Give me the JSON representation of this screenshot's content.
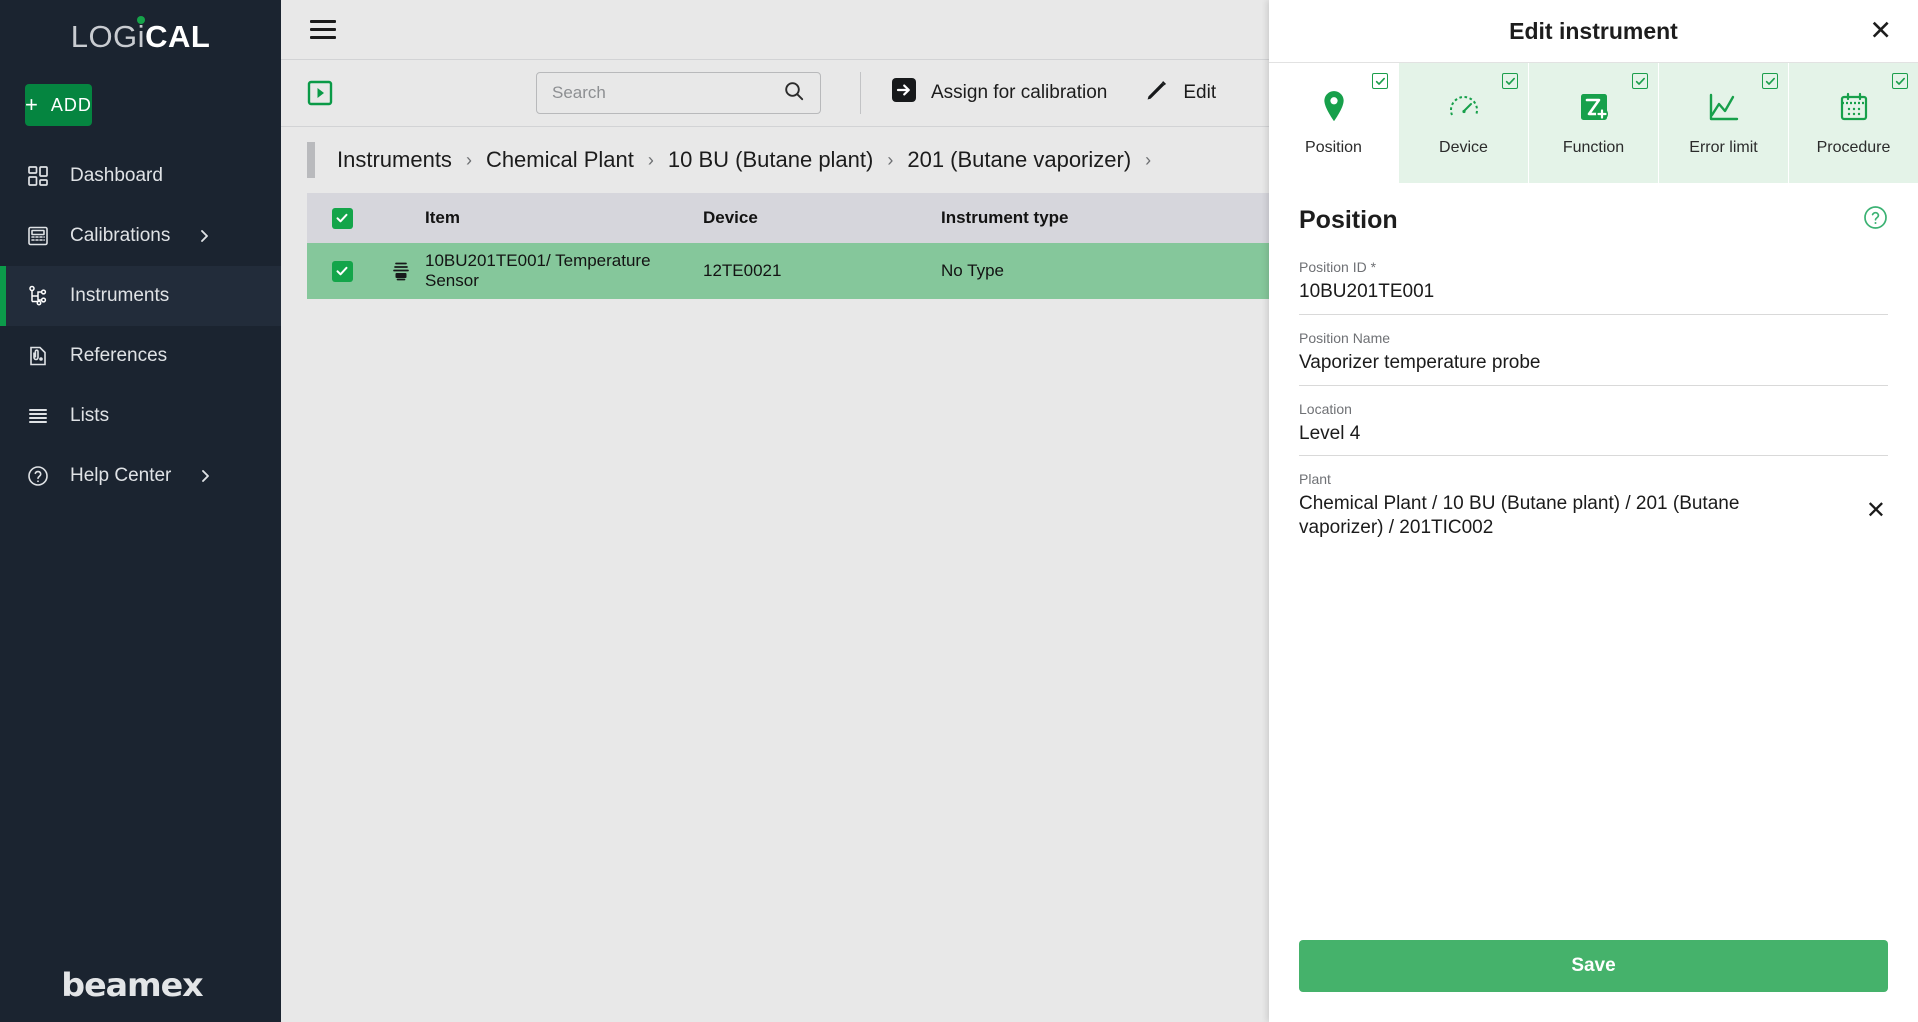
{
  "brand": {
    "logo_light": "LOG",
    "logo_i": "i",
    "logo_bold": "CAL",
    "footer_logo": "beamex",
    "accent_green": "#0c9b4a",
    "add_green": "#058540",
    "row_green": "#85c79b",
    "save_green": "#45b26b",
    "sidebar_bg": "#1b2430"
  },
  "sidebar": {
    "add_label": "ADD",
    "add_plus": "+",
    "items": [
      {
        "label": "Dashboard",
        "icon": "dashboard-icon",
        "active": false,
        "chevron": false
      },
      {
        "label": "Calibrations",
        "icon": "calibrator-icon",
        "active": false,
        "chevron": true
      },
      {
        "label": "Instruments",
        "icon": "instruments-icon",
        "active": true,
        "chevron": false
      },
      {
        "label": "References",
        "icon": "reference-icon",
        "active": false,
        "chevron": false
      },
      {
        "label": "Lists",
        "icon": "lists-icon",
        "active": false,
        "chevron": false
      },
      {
        "label": "Help Center",
        "icon": "help-icon",
        "active": false,
        "chevron": true
      }
    ]
  },
  "topbar": {
    "menu_icon": "hamburger-icon"
  },
  "toolbar": {
    "play_icon": "play-square-icon",
    "search": {
      "value": "",
      "placeholder": "Search",
      "icon": "search-icon"
    },
    "actions": [
      {
        "label": "Assign for calibration",
        "icon": "assign-arrow-icon"
      },
      {
        "label": "Edit",
        "icon": "pencil-icon"
      }
    ]
  },
  "breadcrumb": {
    "items": [
      "Instruments",
      "Chemical Plant",
      "10 BU (Butane plant)",
      "201 (Butane vaporizer)"
    ],
    "separator": "›"
  },
  "table": {
    "columns": [
      "Item",
      "Device",
      "Instrument type"
    ],
    "header_checkbox_checked": true,
    "rows": [
      {
        "checked": true,
        "icon": "instrument-icon",
        "item": "10BU201TE001/ Temperature Sensor",
        "device": "12TE0021",
        "instrument_type": "No Type"
      }
    ]
  },
  "panel": {
    "title": "Edit instrument",
    "close_icon": "close-icon",
    "tabs": [
      {
        "label": "Position",
        "icon": "map-pin-icon",
        "active": true,
        "checked": true
      },
      {
        "label": "Device",
        "icon": "gauge-icon",
        "active": false,
        "checked": true
      },
      {
        "label": "Function",
        "icon": "function-icon",
        "active": false,
        "checked": true
      },
      {
        "label": "Error limit",
        "icon": "chart-line-icon",
        "active": false,
        "checked": true
      },
      {
        "label": "Procedure",
        "icon": "calendar-icon",
        "active": false,
        "checked": true
      }
    ],
    "section_title": "Position",
    "help_icon": "help-circle-icon",
    "fields": [
      {
        "label": "Position ID *",
        "value": "10BU201TE001",
        "clearable": false
      },
      {
        "label": "Position Name",
        "value": "Vaporizer temperature probe",
        "clearable": false
      },
      {
        "label": "Location",
        "value": "Level 4",
        "clearable": false
      },
      {
        "label": "Plant",
        "value": "Chemical Plant / 10 BU (Butane plant) / 201 (Butane vaporizer) / 201TIC002",
        "clearable": true
      }
    ],
    "save_label": "Save"
  }
}
